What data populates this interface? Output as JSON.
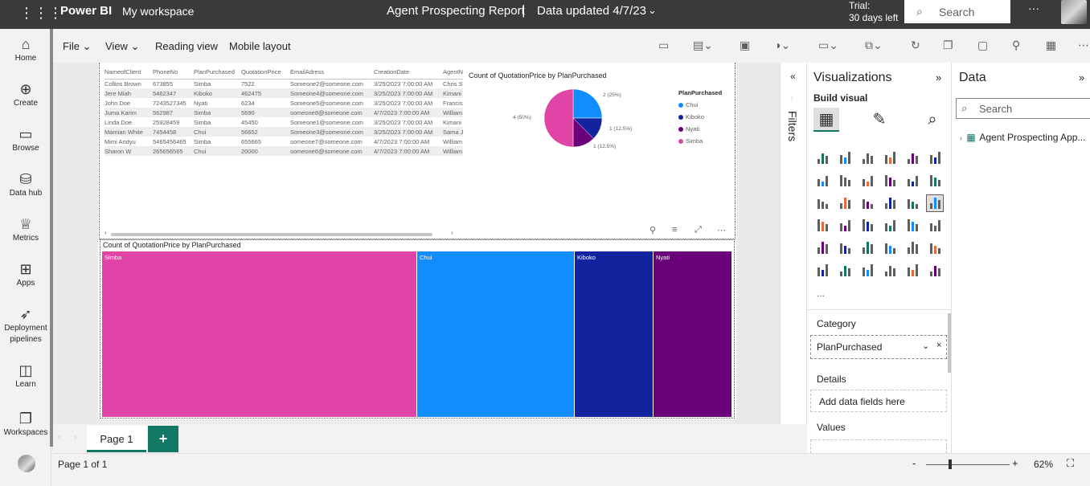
{
  "topbar": {
    "brand": "Power BI",
    "workspace": "My workspace",
    "report_title": "Agent Prospecting Report",
    "separator": "|",
    "updated": "Data updated 4/7/23",
    "trial_line1": "Trial:",
    "trial_line2": "30 days left",
    "search_placeholder": "Search",
    "more": "···"
  },
  "leftnav": {
    "items": [
      {
        "label": "Home",
        "icon": "home-icon"
      },
      {
        "label": "Create",
        "icon": "plus-circle-icon"
      },
      {
        "label": "Browse",
        "icon": "folder-icon"
      },
      {
        "label": "Data hub",
        "icon": "database-icon"
      },
      {
        "label": "Metrics",
        "icon": "trophy-icon"
      },
      {
        "label": "Apps",
        "icon": "apps-icon"
      },
      {
        "label": "Deployment pipelines",
        "icon": "rocket-icon"
      },
      {
        "label": "Learn",
        "icon": "book-icon"
      },
      {
        "label": "Workspaces",
        "icon": "workspaces-icon"
      }
    ]
  },
  "toolbar": {
    "file": "File",
    "view": "View",
    "reading_view": "Reading view",
    "mobile_layout": "Mobile layout"
  },
  "table": {
    "columns": [
      "NameofClient",
      "PhoneNo",
      "PlanPurchased",
      "QuotationPrice",
      "EmailAdress",
      "CreationDate",
      "AgentN"
    ],
    "rows": [
      [
        "Collins Brown",
        "673855",
        "Simba",
        "7522",
        "Someone2@someone.com",
        "3/25/2023 7:00:00 AM",
        "Chris S"
      ],
      [
        "Jere Miah",
        "5462347",
        "Kiboko",
        "462475",
        "Someone4@someone.com",
        "3/25/2023 7:00:00 AM",
        "Kimani"
      ],
      [
        "John Doe",
        "7243527345",
        "Nyati",
        "6234",
        "Someone5@someone.com",
        "3/25/2023 7:00:00 AM",
        "Francis"
      ],
      [
        "Juma Karim",
        "562987",
        "Simba",
        "5690",
        "someone8@someone.com",
        "4/7/2023 7:00:00 AM",
        "William"
      ],
      [
        "Linda Doe",
        "25928459",
        "Simba",
        "45450",
        "Someone1@someone.com",
        "3/25/2023 7:00:00 AM",
        "Kimani"
      ],
      [
        "Mamian White",
        "7454458",
        "Chui",
        "56652",
        "Someone3@someone.com",
        "3/25/2023 7:00:00 AM",
        "Sama J"
      ],
      [
        "Mimi Andyu",
        "5465456465",
        "Simba",
        "655665",
        "someone7@someone.com",
        "4/7/2023 7:00:00 AM",
        "William"
      ],
      [
        "Sharon W",
        "265656565",
        "Chui",
        "20000",
        "someone6@someone.com",
        "4/7/2023 7:00:00 AM",
        "William"
      ]
    ]
  },
  "chart_data": [
    {
      "type": "pie",
      "title": "Count of QuotationPrice by PlanPurchased",
      "legend_title": "PlanPurchased",
      "legend_position": "right",
      "categories": [
        "Chui",
        "Kiboko",
        "Nyati",
        "Simba"
      ],
      "values": [
        2,
        1,
        1,
        4
      ],
      "data_labels": [
        "2 (25%)",
        "1 (12.5%)",
        "1 (12.5%)",
        "4 (50%)"
      ],
      "colors": [
        "#118dff",
        "#12239e",
        "#6b007b",
        "#e044a7"
      ]
    },
    {
      "type": "treemap",
      "title": "Count of QuotationPrice by PlanPurchased",
      "categories": [
        "Simba",
        "Chui",
        "Kiboko",
        "Nyati"
      ],
      "values": [
        4,
        2,
        1,
        1
      ],
      "colors": [
        "#e044a7",
        "#118dff",
        "#12239e",
        "#6b007b"
      ]
    }
  ],
  "pages": {
    "tab": "Page 1",
    "add": "+",
    "status": "Page 1 of 1",
    "zoom": "62%",
    "minus": "-",
    "plus": "+"
  },
  "filters": {
    "label": "Filters"
  },
  "visualizations": {
    "title": "Visualizations",
    "build_visual": "Build visual",
    "category_label": "Category",
    "category_field": "PlanPurchased",
    "details_label": "Details",
    "details_placeholder": "Add data fields here",
    "values_label": "Values",
    "more": "..."
  },
  "data_pane": {
    "title": "Data",
    "search_placeholder": "Search",
    "table_name": "Agent Prospecting App..."
  }
}
